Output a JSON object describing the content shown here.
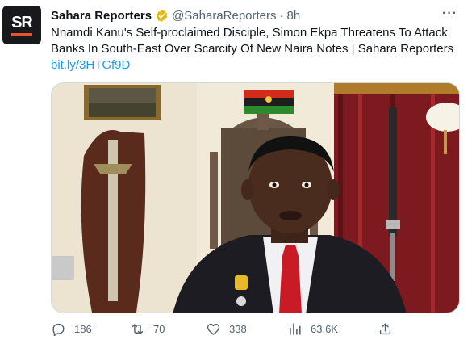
{
  "account": {
    "avatar_text": "SR",
    "name": "Sahara Reporters",
    "handle": "@SaharaReporters",
    "separator": "·",
    "time": "8h"
  },
  "tweet": {
    "text": "Nnamdi Kanu's Self-proclaimed Disciple, Simon Ekpa Threatens To Attack Banks In South-East Over Scarcity Of New Naira Notes | Sahara Reporters",
    "link": "bit.ly/3HTGf9D"
  },
  "stats": {
    "replies": "186",
    "retweets": "70",
    "likes": "338",
    "views": "63.6K"
  },
  "colors": {
    "link": "#1d9bf0",
    "secondary_text": "#536471",
    "verified_badge": "#e2b719"
  }
}
